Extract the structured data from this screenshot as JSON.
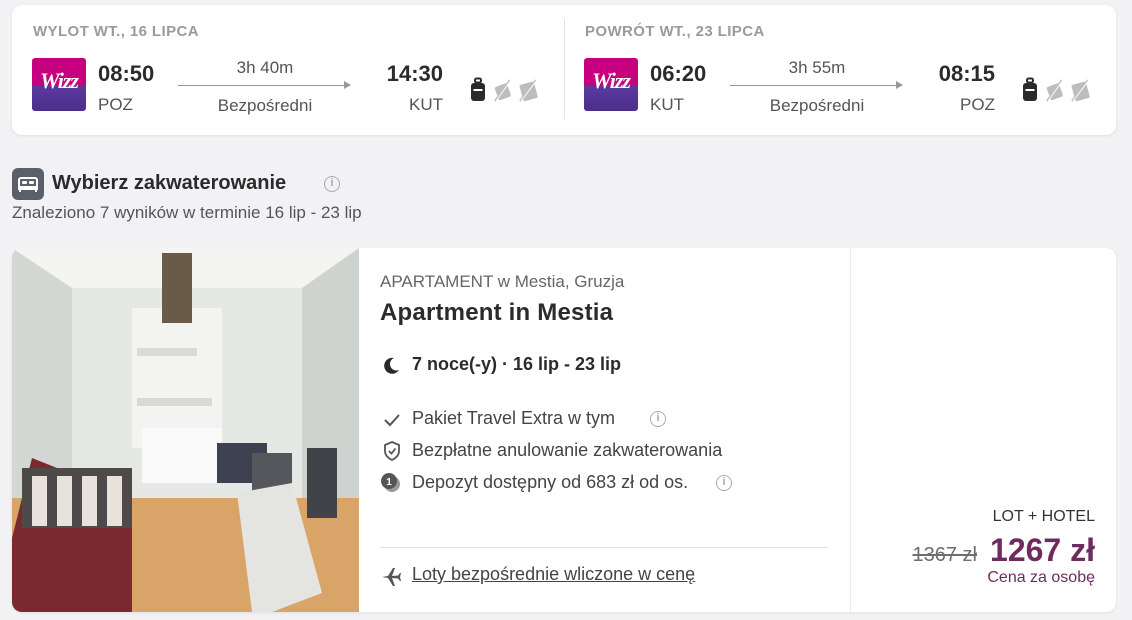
{
  "outbound": {
    "label": "WYLOT WT., 16 LIPCA",
    "airline_logo_text": "Wizz",
    "dep_time": "08:50",
    "dep_code": "POZ",
    "duration": "3h 40m",
    "stops": "Bezpośredni",
    "arr_time": "14:30",
    "arr_code": "KUT"
  },
  "return": {
    "label": "POWRÓT WT., 23 LIPCA",
    "airline_logo_text": "Wizz",
    "dep_time": "06:20",
    "dep_code": "KUT",
    "duration": "3h 55m",
    "stops": "Bezpośredni",
    "arr_time": "08:15",
    "arr_code": "POZ"
  },
  "baggage_icons": [
    "cabin-bag-icon",
    "no-trolley-icon",
    "no-checked-bag-icon"
  ],
  "accommodation": {
    "title": "Wybierz zakwaterowanie",
    "results_text": "Znaleziono 7 wyników w terminie 16 lip - 23 lip"
  },
  "hotel": {
    "type": "APARTAMENT w Mestia, Gruzja",
    "name": "Apartment in Mestia",
    "nights": "7 noce(-y) · 16 lip - 23 lip",
    "features": [
      {
        "icon": "check-icon",
        "text": "Pakiet Travel Extra w tym"
      },
      {
        "icon": "shield-check-icon",
        "text": "Bezpłatne anulowanie zakwaterowania"
      },
      {
        "icon": "deposit-coin-icon",
        "text": "Depozyt dostępny od 683 zł od os."
      }
    ],
    "flights_link": "Loty bezpośrednie wliczone w cenę",
    "package_label": "LOT + HOTEL",
    "old_price": "1367 zł",
    "price": "1267 zł",
    "price_note": "Cena za osobę"
  },
  "colors": {
    "price_accent": "#6e2b5e",
    "wizz_pink": "#c6007e",
    "wizz_purple": "#4b2e8c"
  }
}
